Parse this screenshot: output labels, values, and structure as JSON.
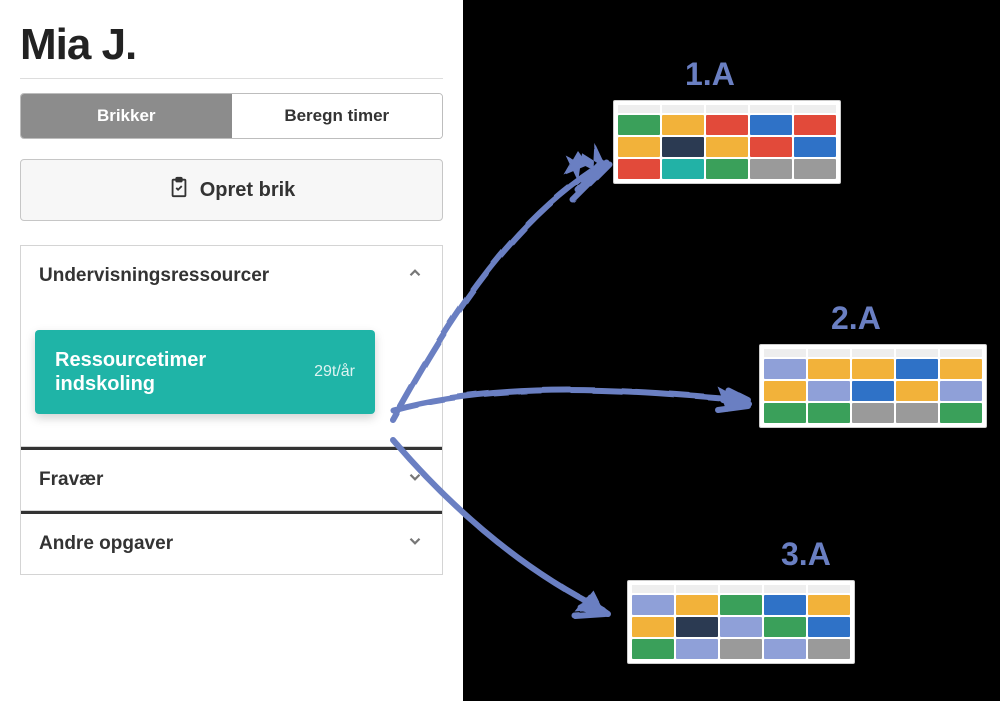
{
  "page_title": "Mia J.",
  "tabs": {
    "active": "Brikker",
    "inactive": "Beregn timer"
  },
  "create_button": "Opret brik",
  "accordion": {
    "section1": {
      "title": "Undervisningsressourcer",
      "card_label": "Ressourcetimer indskoling",
      "card_amount": "29t/år"
    },
    "section2": {
      "title": "Fravær"
    },
    "section3": {
      "title": "Andre opgaver"
    }
  },
  "classes": {
    "a": "1.A",
    "b": "2.A",
    "c": "3.A"
  }
}
